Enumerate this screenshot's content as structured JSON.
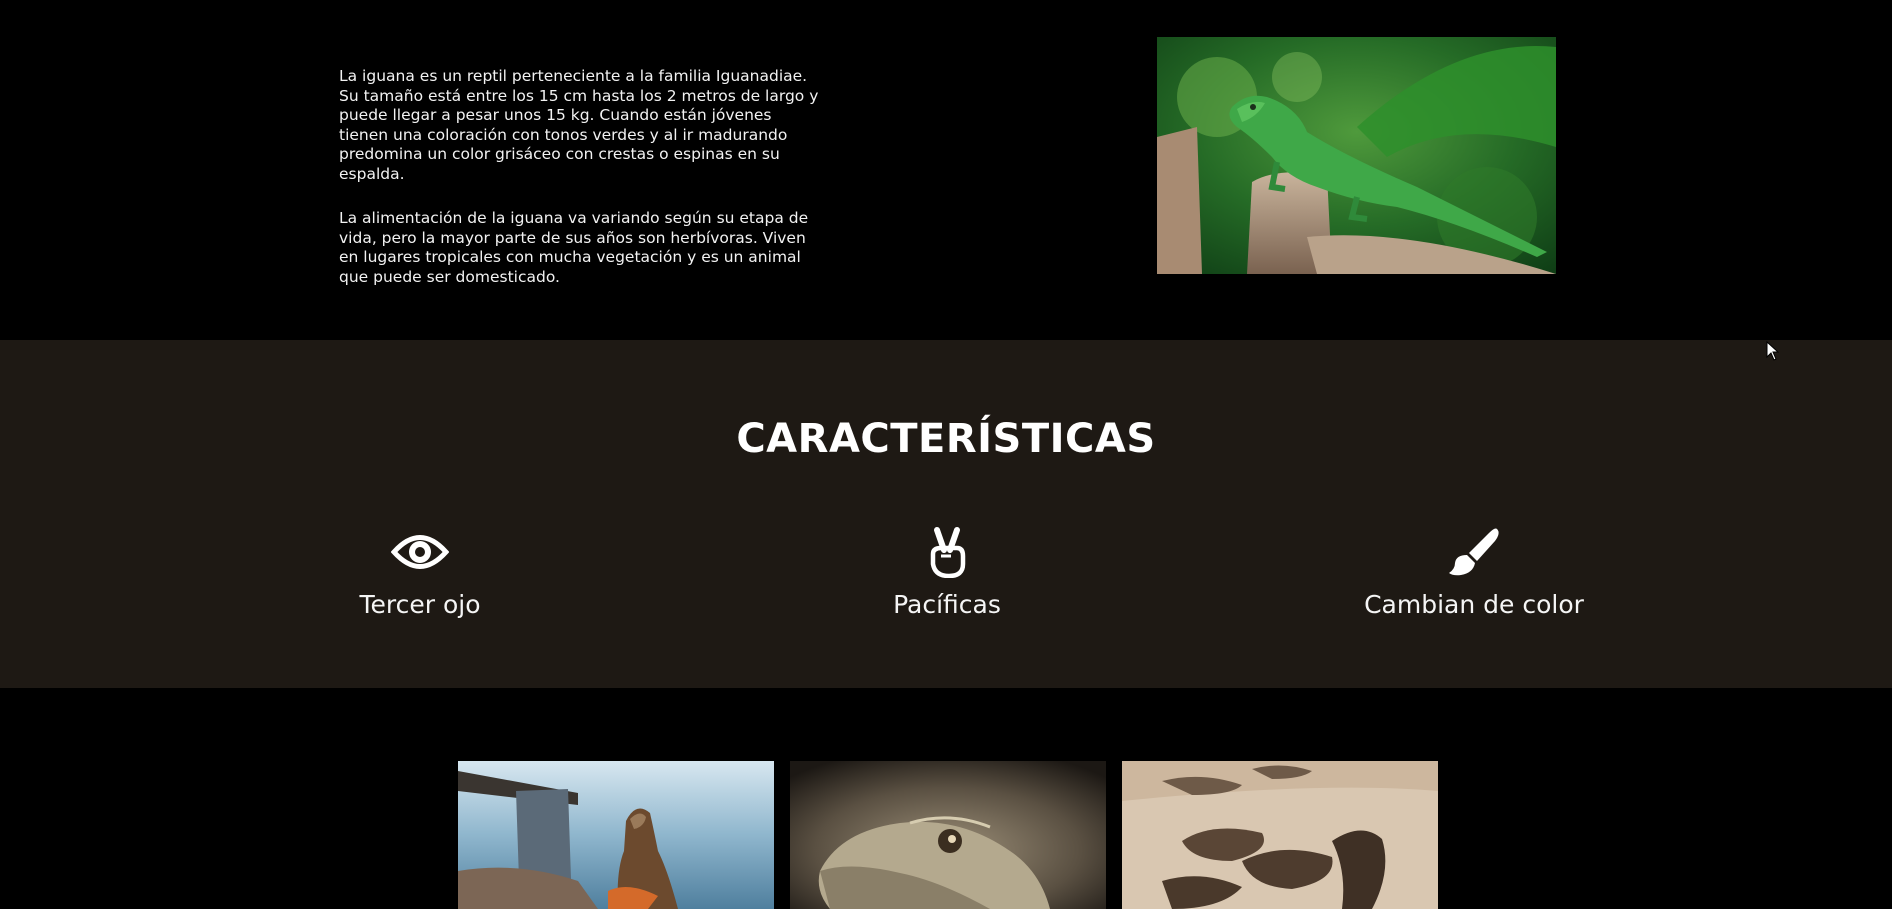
{
  "intro": {
    "paragraphs": [
      "La iguana es un reptil perteneciente a la familia Iguanadiae. Su tamaño está entre los 15 cm hasta los 2 metros de largo y puede llegar a pesar unos 15 kg. Cuando están jóvenes tienen una coloración con tonos verdes y al ir madurando predomina un color grisáceo con crestas o espinas en su espalda.",
      "La alimentación de la iguana va variando según su etapa de vida, pero la mayor parte de sus años son herbívoras. Viven en lugares tropicales con mucha vegetación y es un animal que puede ser domesticado."
    ],
    "photo_subject": "green-iguana-on-stump"
  },
  "features": {
    "title": "CARACTERÍSTICAS",
    "items": [
      {
        "label": "Tercer ojo",
        "icon": "eye-icon"
      },
      {
        "label": "Pacíficas",
        "icon": "peace-hand-icon"
      },
      {
        "label": "Cambian de color",
        "icon": "paint-brush-icon"
      }
    ]
  },
  "gallery": {
    "images": [
      "iguana-by-sea",
      "iguana-head-closeup",
      "iguanas-on-sand"
    ]
  },
  "colors": {
    "page_background": "#000000",
    "features_background": "#1e1914",
    "text": "#ffffff"
  }
}
